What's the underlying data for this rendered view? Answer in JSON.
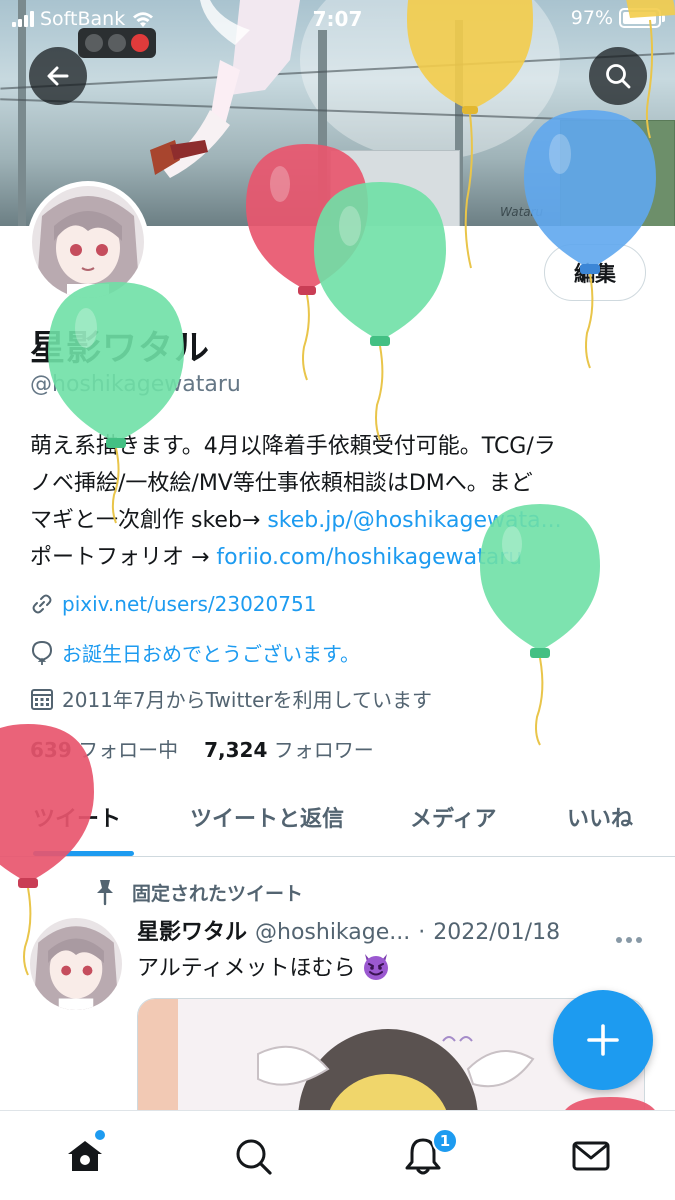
{
  "status_bar": {
    "carrier": "SoftBank",
    "time": "7:07",
    "battery": "97%",
    "battery_level": 0.97
  },
  "profile": {
    "edit_label": "編集",
    "display_name": "星影ワタル",
    "handle": "@hoshikagewataru",
    "bio": {
      "line1": "萌え系描きます。4月以降着手依頼受付可能。TCG/ラ",
      "line2": "ノベ挿絵/一枚絵/MV等仕事依頼相談はDMへ。まど",
      "line3_text": "マギと一次創作 skeb→ ",
      "line3_link": "skeb.jp/@hoshikagewata...",
      "line4_text": "ポートフォリオ → ",
      "line4_link": "foriio.com/hoshikagewataru"
    },
    "website": "pixiv.net/users/23020751",
    "birthday": "お誕生日おめでとうございます。",
    "joined": "2011年7月からTwitterを利用しています",
    "following_count": "639",
    "following_label": "フォロー中",
    "followers_count": "7,324",
    "followers_label": "フォロワー"
  },
  "tabs": [
    {
      "label": "ツイート",
      "active": true
    },
    {
      "label": "ツイートと返信",
      "active": false
    },
    {
      "label": "メディア",
      "active": false
    },
    {
      "label": "いいね",
      "active": false
    }
  ],
  "pinned_tweet": {
    "pinned_label": "固定されたツイート",
    "name": "星影ワタル",
    "handle": "@hoshikage...",
    "separator": "·",
    "date": "2022/01/18",
    "text": "アルティメットほむら",
    "emoji": "smiling-devil-icon"
  },
  "nav": {
    "notification_count": "1",
    "icons": [
      "home-icon",
      "search-icon",
      "notifications-icon",
      "messages-icon"
    ]
  },
  "colors": {
    "accent": "#1d9bf0",
    "text": "#14171a",
    "secondary_text": "#536471",
    "balloon_red": "#e8566e",
    "balloon_green": "#6fe0a6",
    "balloon_blue": "#5fa7ee",
    "balloon_yellow": "#f3cc4a"
  }
}
